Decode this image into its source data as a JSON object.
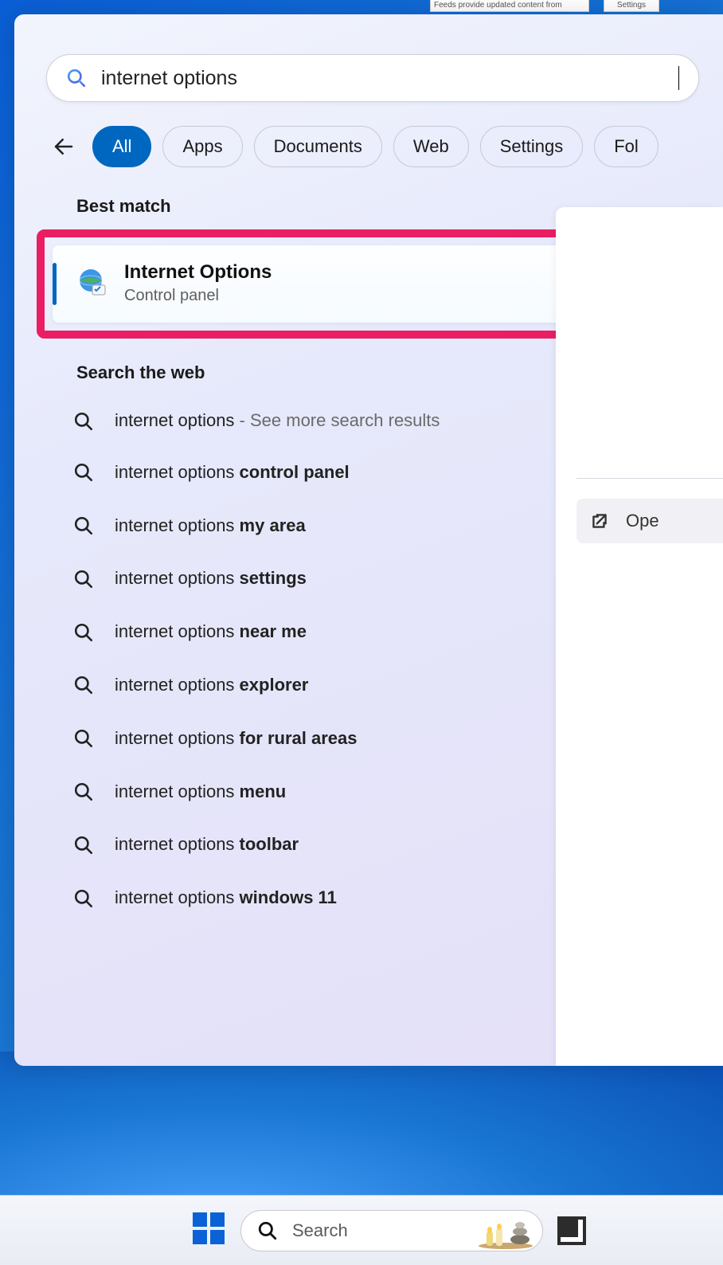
{
  "background_snippets": {
    "feeds_text": "Feeds provide updated content from",
    "settings_label": "Settings"
  },
  "search": {
    "query": "internet options"
  },
  "filters": {
    "all": "All",
    "apps": "Apps",
    "documents": "Documents",
    "web": "Web",
    "settings": "Settings",
    "folders": "Fol"
  },
  "sections": {
    "best_match": "Best match",
    "search_web": "Search the web"
  },
  "best_match": {
    "title": "Internet Options",
    "subtitle": "Control panel"
  },
  "web_results": [
    {
      "prefix": "internet options",
      "bold": "",
      "hint": " - See more search results"
    },
    {
      "prefix": "internet options ",
      "bold": "control panel",
      "hint": ""
    },
    {
      "prefix": "internet options ",
      "bold": "my area",
      "hint": ""
    },
    {
      "prefix": "internet options ",
      "bold": "settings",
      "hint": ""
    },
    {
      "prefix": "internet options ",
      "bold": "near me",
      "hint": ""
    },
    {
      "prefix": "internet options ",
      "bold": "explorer",
      "hint": ""
    },
    {
      "prefix": "internet options ",
      "bold": "for rural areas",
      "hint": ""
    },
    {
      "prefix": "internet options ",
      "bold": "menu",
      "hint": ""
    },
    {
      "prefix": "internet options ",
      "bold": "toolbar",
      "hint": ""
    },
    {
      "prefix": "internet options ",
      "bold": "windows 11",
      "hint": ""
    }
  ],
  "preview": {
    "open_label": "Ope"
  },
  "taskbar": {
    "search_placeholder": "Search"
  }
}
